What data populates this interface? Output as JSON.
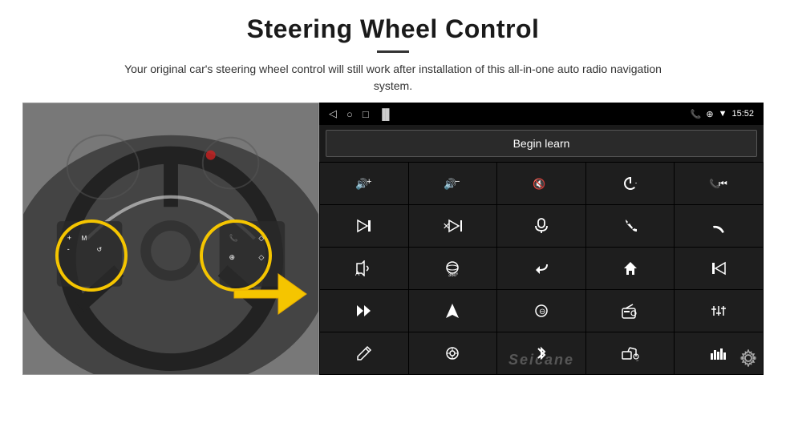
{
  "header": {
    "title": "Steering Wheel Control",
    "subtitle": "Your original car's steering wheel control will still work after installation of this all-in-one auto radio navigation system."
  },
  "status_bar": {
    "time": "15:52",
    "nav_back": "◁",
    "nav_home": "○",
    "nav_recent": "□",
    "icons_right": "📞 ⊕ ▼"
  },
  "begin_learn_button": "Begin learn",
  "controls": [
    {
      "icon": "🔊+",
      "name": "vol-up"
    },
    {
      "icon": "🔊−",
      "name": "vol-down"
    },
    {
      "icon": "🔇",
      "name": "mute"
    },
    {
      "icon": "⏻",
      "name": "power"
    },
    {
      "icon": "📞⏮",
      "name": "call-prev"
    },
    {
      "icon": "⏭",
      "name": "next-track"
    },
    {
      "icon": "⏮⏭",
      "name": "skip"
    },
    {
      "icon": "🎙",
      "name": "mic"
    },
    {
      "icon": "📞",
      "name": "phone"
    },
    {
      "icon": "↩",
      "name": "hang-up"
    },
    {
      "icon": "📢",
      "name": "audio-src"
    },
    {
      "icon": "⊕",
      "name": "360"
    },
    {
      "icon": "↺",
      "name": "return"
    },
    {
      "icon": "🏠",
      "name": "home"
    },
    {
      "icon": "⏮⏮",
      "name": "prev-track"
    },
    {
      "icon": "⏭⏭",
      "name": "fast-fwd"
    },
    {
      "icon": "➤",
      "name": "nav"
    },
    {
      "icon": "⊖",
      "name": "eject"
    },
    {
      "icon": "📻",
      "name": "radio"
    },
    {
      "icon": "⚙",
      "name": "eq"
    },
    {
      "icon": "✎",
      "name": "pen"
    },
    {
      "icon": "◎",
      "name": "circle-menu"
    },
    {
      "icon": "✦",
      "name": "bluetooth"
    },
    {
      "icon": "🎵",
      "name": "music"
    },
    {
      "icon": "||||",
      "name": "spectrum"
    }
  ],
  "watermark": "Seicane",
  "gear_icon": "⚙"
}
